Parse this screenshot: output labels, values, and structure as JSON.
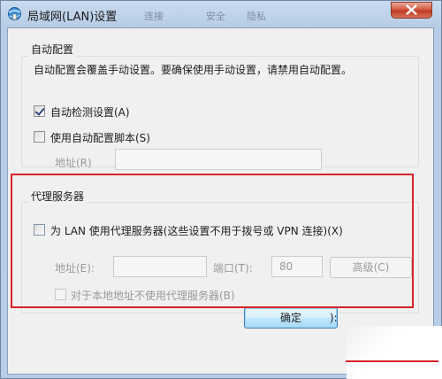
{
  "window": {
    "title": "局域网(LAN)设置",
    "ghost_tabs": [
      "连接",
      "",
      "安全",
      "隐私"
    ]
  },
  "auto_config": {
    "group_title": "自动配置",
    "description": "自动配置会覆盖手动设置。要确保使用手动设置，请禁用自动配置。",
    "auto_detect_label": "自动检测设置(A)",
    "auto_detect_checked": true,
    "use_script_label": "使用自动配置脚本(S)",
    "use_script_checked": false,
    "address_label": "地址(R)",
    "address_value": ""
  },
  "proxy": {
    "group_title": "代理服务器",
    "use_proxy_label": "为 LAN 使用代理服务器(这些设置不用于拨号或 VPN 连接)(X)",
    "use_proxy_checked": false,
    "address_label": "地址(E):",
    "address_value": "",
    "port_label": "端口(T):",
    "port_value": "80",
    "advanced_label": "高级(C)",
    "bypass_label": "对于本地地址不使用代理服务器(B)",
    "bypass_checked": false
  },
  "footer": {
    "ok_label": "确定",
    "cancel_label": "):"
  },
  "colors": {
    "highlight": "#d8232a",
    "ok_border": "#3c7fb1"
  },
  "icons": {
    "app": "ie-globe-icon",
    "close": "close-icon"
  }
}
